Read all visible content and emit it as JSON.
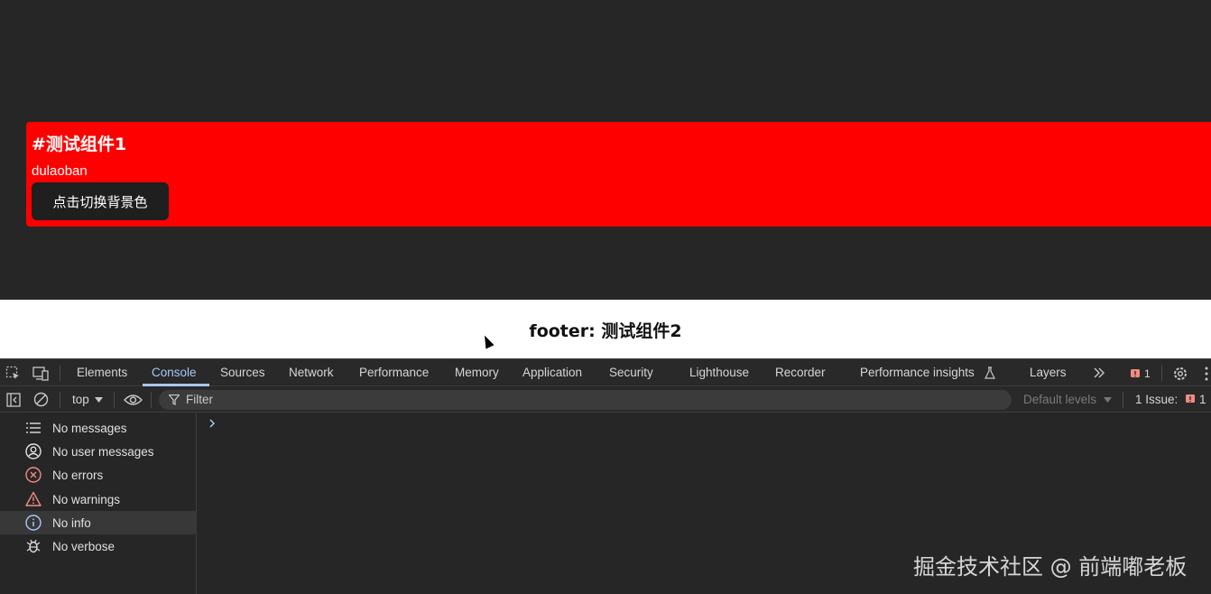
{
  "page": {
    "component1": {
      "title": "#测试组件1",
      "name": "dulaoban",
      "button_label": "点击切换背景色",
      "background_color": "#ff0000"
    },
    "footer": {
      "text": "footer: 测试组件2"
    }
  },
  "devtools": {
    "tabs": [
      {
        "label": "Elements"
      },
      {
        "label": "Console"
      },
      {
        "label": "Sources"
      },
      {
        "label": "Network"
      },
      {
        "label": "Performance"
      },
      {
        "label": "Memory"
      },
      {
        "label": "Application"
      },
      {
        "label": "Security"
      },
      {
        "label": "Lighthouse"
      },
      {
        "label": "Recorder"
      },
      {
        "label": "Performance insights"
      },
      {
        "label": "Layers"
      }
    ],
    "active_tab": "Console",
    "issues_badge_count": "1",
    "toolbar": {
      "context": "top",
      "filter_placeholder": "Filter",
      "levels": "Default levels",
      "issues_label": "1 Issue:",
      "issues_count": "1"
    },
    "sidebar": {
      "items": [
        {
          "label": "No messages",
          "icon": "list-icon"
        },
        {
          "label": "No user messages",
          "icon": "user-circle-icon"
        },
        {
          "label": "No errors",
          "icon": "error-icon"
        },
        {
          "label": "No warnings",
          "icon": "warning-icon"
        },
        {
          "label": "No info",
          "icon": "info-icon"
        },
        {
          "label": "No verbose",
          "icon": "bug-icon"
        }
      ],
      "selected": "No info"
    },
    "colors": {
      "accent": "#a8c7fa",
      "error": "#f28b82",
      "warning": "#f9ab00",
      "issue": "#f28b82"
    }
  },
  "watermark": "掘金技术社区 @ 前端嘟老板"
}
